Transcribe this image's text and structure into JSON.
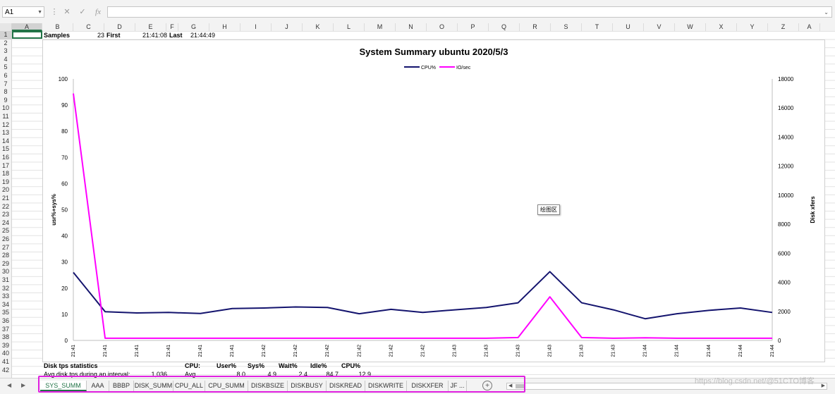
{
  "formula_bar": {
    "name_box": "A1",
    "cancel_icon": "✕",
    "enter_icon": "✓",
    "fx_label": "fx",
    "formula": ""
  },
  "columns": [
    "A",
    "B",
    "C",
    "D",
    "E",
    "F",
    "G",
    "H",
    "I",
    "J",
    "K",
    "L",
    "M",
    "N",
    "O",
    "P",
    "Q",
    "R",
    "S",
    "T",
    "U",
    "V",
    "W",
    "X",
    "Y",
    "Z",
    "A"
  ],
  "rows": [
    "1",
    "2",
    "3",
    "4",
    "5",
    "6",
    "7",
    "8",
    "9",
    "10",
    "11",
    "12",
    "13",
    "14",
    "15",
    "16",
    "17",
    "18",
    "19",
    "20",
    "21",
    "22",
    "23",
    "24",
    "25",
    "26",
    "27",
    "28",
    "29",
    "30",
    "31",
    "32",
    "33",
    "34",
    "35",
    "36",
    "37",
    "38",
    "39",
    "40",
    "41",
    "42"
  ],
  "row1": {
    "samples_label": "Samples",
    "samples_value": "23",
    "first_label": "First",
    "first_value": "21:41:08",
    "last_label": "Last",
    "last_value": "21:44:49"
  },
  "row41": {
    "disk_label": "Disk tps statistics",
    "cpu_label": "CPU:",
    "user_label": "User%",
    "sys_label": "Sys%",
    "wait_label": "Wait%",
    "idle_label": "Idle%",
    "cpu_pct_label": "CPU%"
  },
  "row42": {
    "disk_label": "Avg disk tps during an interval:",
    "disk_value": "1,036",
    "avg_label": "Avg",
    "user_value": "8.0",
    "sys_value": "4.9",
    "wait_value": "2.4",
    "idle_value": "84.7",
    "cpu_pct_value": "12.9"
  },
  "chart_tooltip": "绘图区",
  "chart_data": {
    "type": "line",
    "title": "System Summary ubuntu  2020/5/3",
    "ylabel": "usr%+sys%",
    "y2label": "Disk xfers",
    "ylim": [
      0,
      100
    ],
    "y2lim": [
      0,
      18000
    ],
    "yticks": [
      0,
      10,
      20,
      30,
      40,
      50,
      60,
      70,
      80,
      90,
      100
    ],
    "y2ticks": [
      0,
      2000,
      4000,
      6000,
      8000,
      10000,
      12000,
      14000,
      16000,
      18000
    ],
    "grid": false,
    "legend_position": "top",
    "categories": [
      "21:41",
      "21:41",
      "21:41",
      "21:41",
      "21:41",
      "21:41",
      "21:42",
      "21:42",
      "21:42",
      "21:42",
      "21:42",
      "21:42",
      "21:43",
      "21:43",
      "21:43",
      "21:43",
      "21:43",
      "21:43",
      "21:44",
      "21:44",
      "21:44",
      "21:44",
      "21:44"
    ],
    "series": [
      {
        "name": "CPU%",
        "axis": "left",
        "color": "#14146e",
        "values": [
          26,
          11,
          10.5,
          10.7,
          10.3,
          12.2,
          12.4,
          12.8,
          12.6,
          10.2,
          11.9,
          10.7,
          11.7,
          12.6,
          14.4,
          26.3,
          14.4,
          11.7,
          8.3,
          10.2,
          11.5,
          12.4,
          10.7
        ]
      },
      {
        "name": "IO/sec",
        "axis": "right",
        "color": "#ff00ff",
        "values": [
          17000,
          150,
          150,
          150,
          150,
          150,
          150,
          150,
          150,
          150,
          150,
          150,
          150,
          150,
          200,
          3000,
          200,
          150,
          180,
          150,
          150,
          150,
          150
        ]
      }
    ]
  },
  "sheet_tabs": [
    "SYS_SUMM",
    "AAA",
    "BBBP",
    "DISK_SUMM",
    "CPU_ALL",
    "CPU_SUMM",
    "DISKBSIZE",
    "DISKBUSY",
    "DISKREAD",
    "DISKWRITE",
    "DISKXFER",
    "JF ..."
  ],
  "active_tab": "SYS_SUMM",
  "add_sheet_icon": "+",
  "watermark": "https://blog.csdn.net/@51CTO博客",
  "colors": {
    "accent": "#217346",
    "highlight_frame": "#e020e0"
  }
}
